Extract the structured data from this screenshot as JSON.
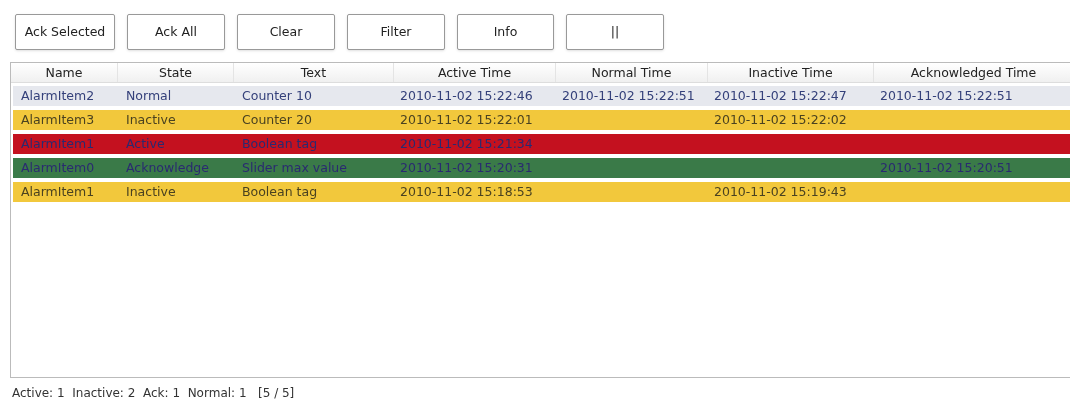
{
  "toolbar": [
    {
      "label": "Ack Selected"
    },
    {
      "label": "Ack All"
    },
    {
      "label": "Clear"
    },
    {
      "label": "Filter"
    },
    {
      "label": "Info"
    },
    {
      "label": "||"
    }
  ],
  "table": {
    "columns": [
      "Name",
      "State",
      "Text",
      "Active Time",
      "Normal Time",
      "Inactive Time",
      "Acknowledged Time"
    ],
    "rows": [
      {
        "color": "#e6e8ee",
        "cells": [
          "AlarmItem2",
          "Normal",
          "Counter 10",
          "2010-11-02 15:22:46",
          "2010-11-02 15:22:51",
          "2010-11-02 15:22:47",
          "2010-11-02 15:22:51"
        ]
      },
      {
        "color": "#f2c83c",
        "cells": [
          "AlarmItem3",
          "Inactive",
          "Counter 20",
          "2010-11-02 15:22:01",
          null,
          "2010-11-02 15:22:02",
          null
        ]
      },
      {
        "color": "#c4111f",
        "cells": [
          "AlarmItem1",
          "Active",
          "Boolean tag",
          "2010-11-02 15:21:34",
          null,
          null,
          null
        ]
      },
      {
        "color": "#3a7a48",
        "cells": [
          "AlarmItem0",
          "Acknowledge",
          "Slider max value",
          "2010-11-02 15:20:31",
          null,
          null,
          "2010-11-02 15:20:51"
        ]
      },
      {
        "color": "#f2c83c",
        "cells": [
          "AlarmItem1",
          "Inactive",
          "Boolean tag",
          "2010-11-02 15:18:53",
          null,
          "2010-11-02 15:19:43",
          null
        ]
      }
    ]
  },
  "status_bar": "Active: 1  Inactive: 2  Ack: 1  Normal: 1   [5 / 5]"
}
